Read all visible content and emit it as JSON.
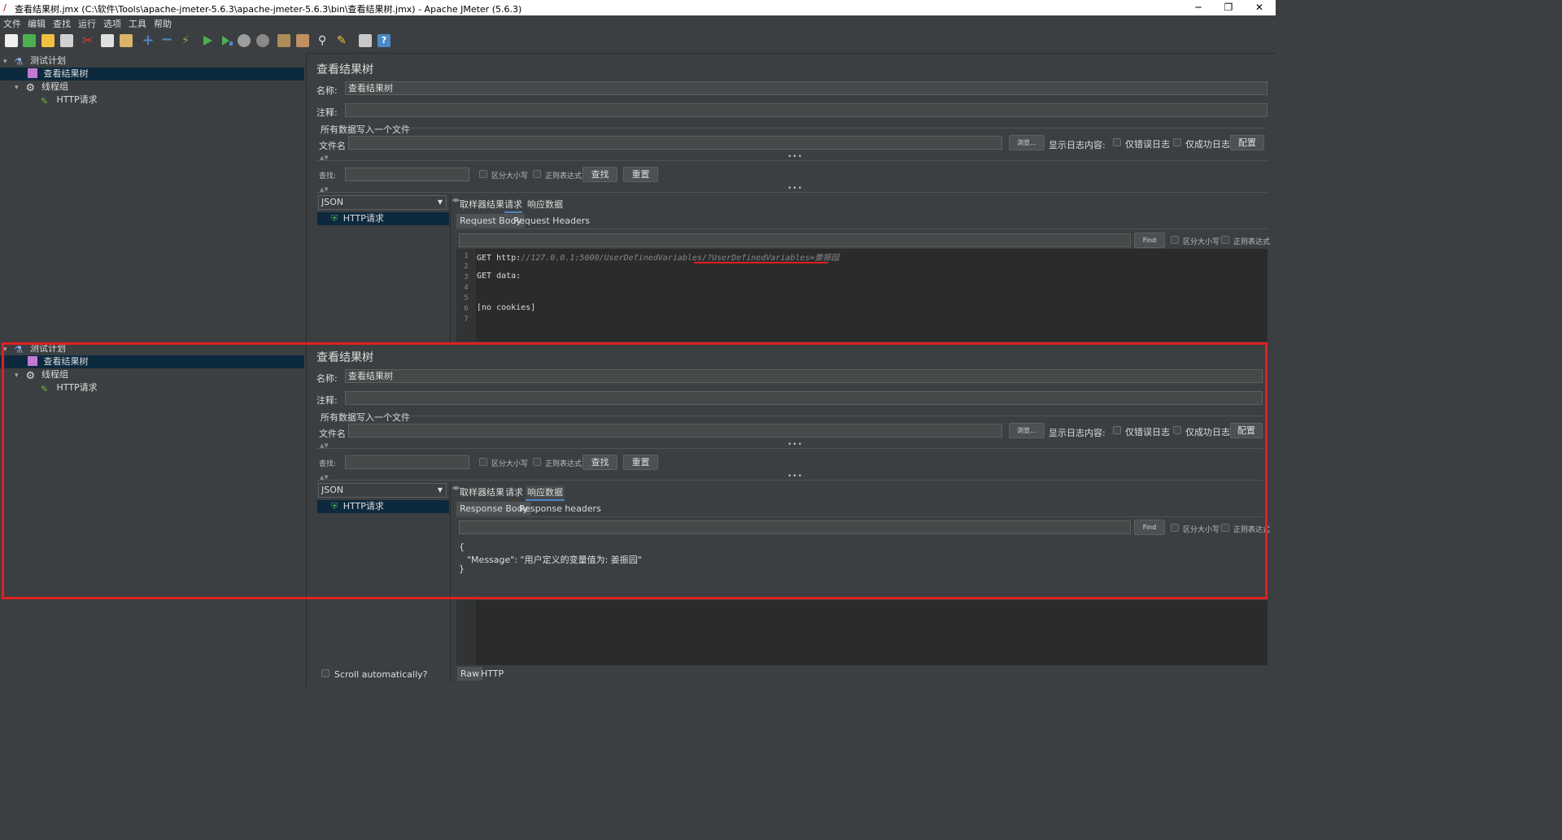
{
  "window": {
    "title": "查看结果树.jmx (C:\\软件\\Tools\\apache-jmeter-5.6.3\\apache-jmeter-5.6.3\\bin\\查看结果树.jmx) - Apache JMeter (5.6.3)",
    "minimize": "─",
    "maximize": "❐",
    "close": "✕"
  },
  "menu": [
    "文件",
    "编辑",
    "查找",
    "运行",
    "选项",
    "工具",
    "帮助"
  ],
  "tree": {
    "test_plan": "测试计划",
    "view_results_tree": "查看结果树",
    "thread_group": "线程组",
    "http_request": "HTTP请求"
  },
  "panel": {
    "title": "查看结果树",
    "name_label": "名称:",
    "name_value": "查看结果树",
    "comment_label": "注释:",
    "comment_value": "",
    "write_all_label": "所有数据写入一个文件",
    "filename_label": "文件名",
    "filename_value": "",
    "browse_button": "浏览...",
    "log_content_label": "显示日志内容:",
    "errors_only": "仅错误日志",
    "success_only": "仅成功日志",
    "configure_button": "配置",
    "search_label": "查找:",
    "search_value": "",
    "case_sensitive": "区分大小写",
    "regex": "正则表达式",
    "find_button": "查找",
    "reset_button": "重置",
    "renderer": "JSON",
    "result_item": "HTTP请求",
    "tabs": [
      "取样器结果",
      "请求",
      "响应数据"
    ],
    "find_small": "Find",
    "scroll_auto": "Scroll automatically?"
  },
  "top_view": {
    "active_tab_index": 1,
    "subtabs": [
      "Request Body",
      "Request Headers"
    ],
    "line_numbers": [
      "1",
      "2",
      "3",
      "4",
      "5",
      "6",
      "7"
    ],
    "code_line1_prefix": "GET http:",
    "code_line1_url": "//127.0.0.1:5000/UserDefinedVariables/?UserDefinedVariables=姜振园",
    "code_line3": "GET data:",
    "code_line6": "[no cookies]"
  },
  "bottom_view": {
    "active_tab_index": 2,
    "subtabs": [
      "Response Body",
      "Response headers"
    ],
    "json_open": "{",
    "json_line": "\"Message\": \"用户定义的变量值为: 姜振园\"",
    "json_close": "}",
    "bottom_tabs": [
      "Raw",
      "HTTP"
    ]
  },
  "colors": {
    "highlight_box": "#e02020",
    "selection": "#0d293e",
    "accent": "#4a88c7"
  }
}
